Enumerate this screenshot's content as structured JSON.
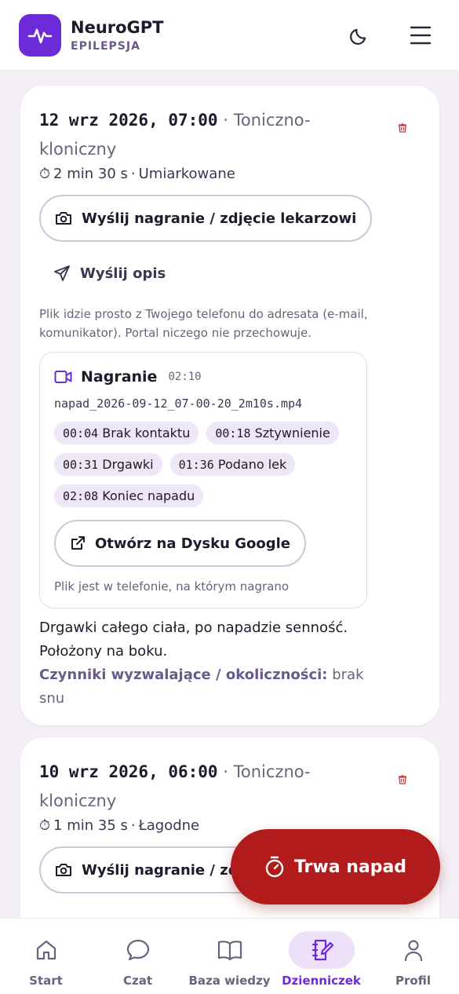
{
  "header": {
    "app_name": "NeuroGPT",
    "subtitle": "EPILEPSJA",
    "icons": [
      "pulse-logo-icon",
      "moon-icon",
      "menu-icon"
    ]
  },
  "entries": [
    {
      "date": "12 wrz 2026, 07:00",
      "separator": "·",
      "type": "Toniczno-kloniczny",
      "duration": "2 min 30 s",
      "severity": "Umiarkowane",
      "send_media_label": "Wyślij nagranie / zdjęcie lekarzowi",
      "send_desc_label": "Wyślij opis",
      "privacy_note": "Plik idzie prosto z Twojego telefonu do adresata (e-mail, komunikator). Portal niczego nie przechowuje.",
      "media": {
        "title": "Nagranie",
        "length": "02:10",
        "filename": "napad_2026-09-12_07-00-20_2m10s.mp4",
        "markers": [
          {
            "time": "00:04",
            "label": "Brak kontaktu"
          },
          {
            "time": "00:18",
            "label": "Sztywnienie"
          },
          {
            "time": "00:31",
            "label": "Drgawki"
          },
          {
            "time": "01:36",
            "label": "Podano lek"
          },
          {
            "time": "02:08",
            "label": "Koniec napadu"
          }
        ],
        "open_label": "Otwórz na Dysku Google",
        "location_note": "Plik jest w telefonie, na którym nagrano"
      },
      "description": "Drgawki całego ciała, po napadzie senność. Położony na boku.",
      "triggers_label": "Czynniki wyzwalające / okoliczności:",
      "triggers_value": "brak snu"
    },
    {
      "date": "10 wrz 2026, 06:00",
      "separator": "·",
      "type": "Toniczno-kloniczny",
      "duration": "1 min 35 s",
      "severity": "Łagodne",
      "send_media_label": "Wyślij nagranie / zdjęcie lekarzowi"
    }
  ],
  "fab": {
    "label": "Trwa napad",
    "color": "#b21b1b"
  },
  "nav": [
    {
      "label": "Start",
      "icon": "home-icon"
    },
    {
      "label": "Czat",
      "icon": "chat-icon"
    },
    {
      "label": "Baza wiedzy",
      "icon": "book-icon"
    },
    {
      "label": "Dzienniczek",
      "icon": "notebook-icon",
      "active": true
    },
    {
      "label": "Profil",
      "icon": "user-icon"
    }
  ],
  "colors": {
    "accent": "#6d2ad9",
    "danger": "#b21b1b",
    "background": "#f4eff7"
  }
}
